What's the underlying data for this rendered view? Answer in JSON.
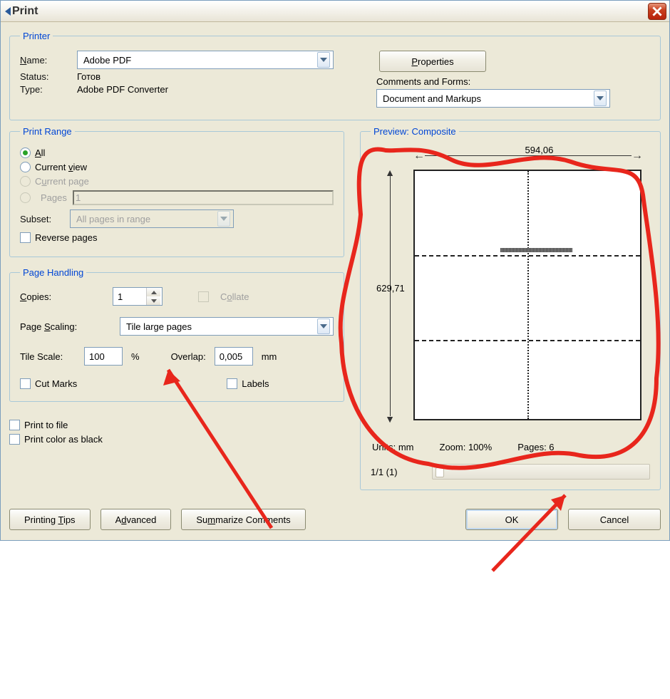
{
  "title": "Print",
  "printer": {
    "legend": "Printer",
    "name_label": "Name:",
    "name_value": "Adobe PDF",
    "status_label": "Status:",
    "status_value": "Готов",
    "type_label": "Type:",
    "type_value": "Adobe PDF Converter",
    "properties_button": "Properties",
    "comments_label": "Comments and Forms:",
    "comments_value": "Document and Markups"
  },
  "print_range": {
    "legend": "Print Range",
    "all": "All",
    "current_view": "Current view",
    "current_page": "Current page",
    "pages": "Pages",
    "pages_value": "1",
    "subset_label": "Subset:",
    "subset_value": "All pages in range",
    "reverse": "Reverse pages"
  },
  "page_handling": {
    "legend": "Page Handling",
    "copies_label": "Copies:",
    "copies_value": "1",
    "collate": "Collate",
    "scaling_label": "Page Scaling:",
    "scaling_value": "Tile large pages",
    "tile_scale_label": "Tile Scale:",
    "tile_scale_value": "100",
    "tile_scale_unit": "%",
    "overlap_label": "Overlap:",
    "overlap_value": "0,005",
    "overlap_unit": "mm",
    "cut_marks": "Cut Marks",
    "labels": "Labels"
  },
  "options": {
    "print_to_file": "Print to file",
    "print_color_as_black": "Print color as black"
  },
  "preview": {
    "legend": "Preview: Composite",
    "width": "594,06",
    "height": "629,71",
    "units": "Units: mm",
    "zoom": "Zoom: 100%",
    "pages": "Pages: 6",
    "page_nav": "1/1 (1)"
  },
  "buttons": {
    "printing_tips": "Printing Tips",
    "advanced": "Advanced",
    "summarize": "Summarize Comments",
    "ok": "OK",
    "cancel": "Cancel"
  }
}
